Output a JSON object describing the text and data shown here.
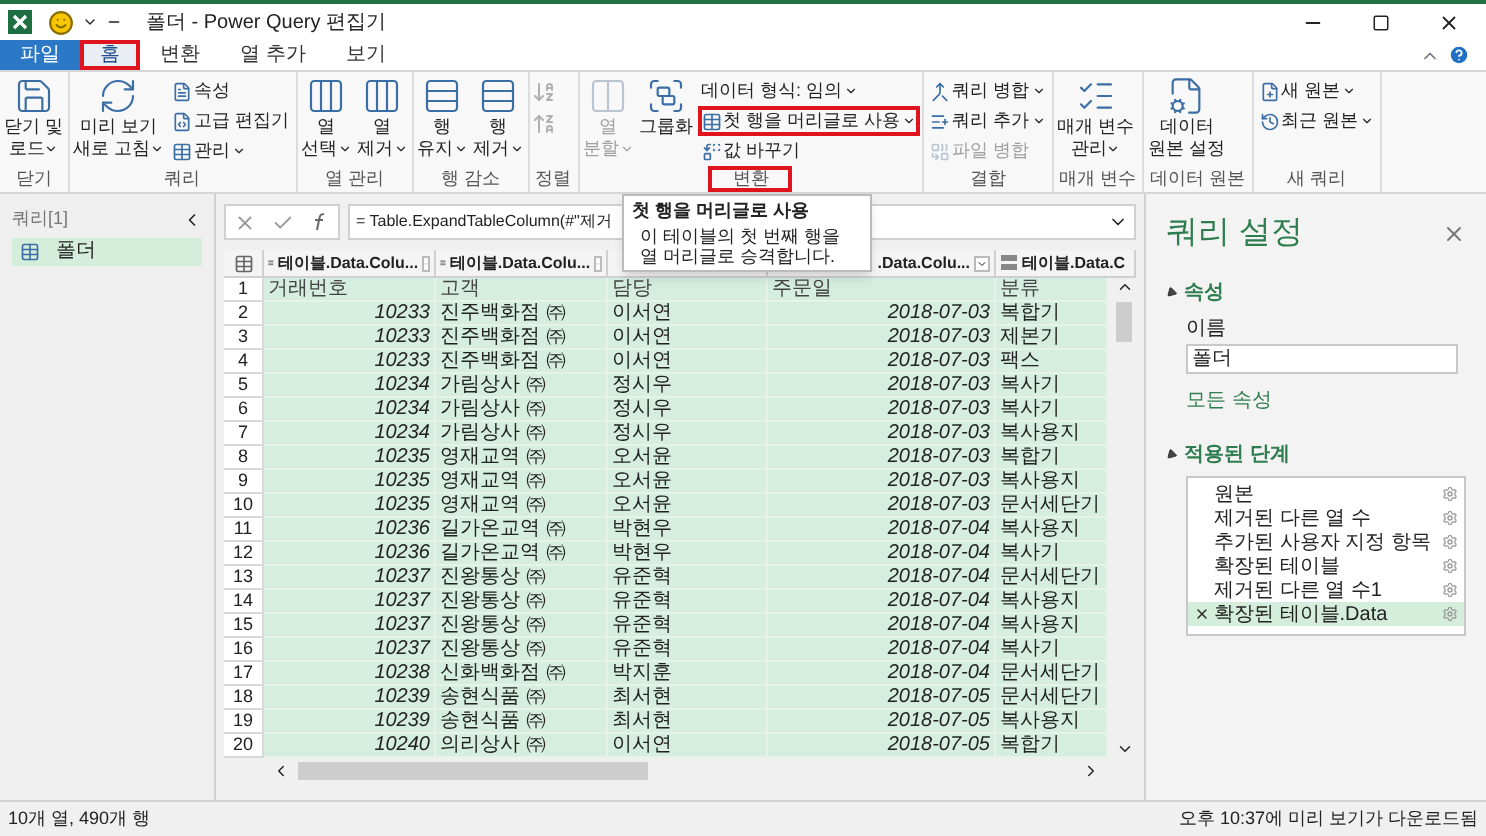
{
  "window": {
    "title": "폴더 - Power Query 편집기"
  },
  "tabs": [
    {
      "label": "파일",
      "kind": "file",
      "selected": false,
      "highlighted": false
    },
    {
      "label": "홈",
      "kind": "tab",
      "selected": true,
      "highlighted": true
    },
    {
      "label": "변환",
      "kind": "tab",
      "selected": false,
      "highlighted": false
    },
    {
      "label": "열 추가",
      "kind": "tab",
      "selected": false,
      "highlighted": false
    },
    {
      "label": "보기",
      "kind": "tab",
      "selected": false,
      "highlighted": false
    }
  ],
  "ribbon": {
    "groups": [
      {
        "label": "닫기",
        "highlighted": false,
        "items": [
          {
            "kind": "large",
            "lines": [
              "닫기 및",
              "로드"
            ],
            "dropdown": true,
            "disabled": false
          }
        ]
      },
      {
        "label": "쿼리",
        "highlighted": false,
        "items": [
          {
            "kind": "large",
            "lines": [
              "미리 보기",
              "새로 고침"
            ],
            "dropdown": true,
            "disabled": false
          },
          {
            "kind": "stack",
            "items": [
              {
                "label": "속성",
                "icon": true,
                "dropdown": false,
                "disabled": false,
                "highlighted": false
              },
              {
                "label": "고급 편집기",
                "icon": true,
                "dropdown": false,
                "disabled": false,
                "highlighted": false
              },
              {
                "label": "관리",
                "icon": true,
                "dropdown": true,
                "disabled": false,
                "highlighted": false
              }
            ]
          }
        ]
      },
      {
        "label": "열 관리",
        "highlighted": false,
        "items": [
          {
            "kind": "large",
            "lines": [
              "열",
              "선택"
            ],
            "dropdown": true,
            "disabled": false
          },
          {
            "kind": "large",
            "lines": [
              "열",
              "제거"
            ],
            "dropdown": true,
            "disabled": false
          }
        ]
      },
      {
        "label": "행 감소",
        "highlighted": false,
        "items": [
          {
            "kind": "large",
            "lines": [
              "행",
              "유지"
            ],
            "dropdown": true,
            "disabled": false
          },
          {
            "kind": "large",
            "lines": [
              "행",
              "제거"
            ],
            "dropdown": true,
            "disabled": false
          }
        ]
      },
      {
        "label": "정렬",
        "highlighted": false,
        "items": [
          {
            "kind": "sort",
            "disabled": true
          }
        ]
      },
      {
        "label": "변환",
        "highlighted": true,
        "items": [
          {
            "kind": "large",
            "lines": [
              "열",
              "분할"
            ],
            "dropdown": true,
            "disabled": true
          },
          {
            "kind": "large",
            "lines": [
              "그룹화"
            ],
            "dropdown": false,
            "disabled": false
          },
          {
            "kind": "stack",
            "items": [
              {
                "label": "데이터 형식: 임의",
                "icon": false,
                "dropdown": true,
                "disabled": false,
                "highlighted": false
              },
              {
                "label": "첫 행을 머리글로 사용",
                "icon": true,
                "dropdown": true,
                "disabled": false,
                "highlighted": true
              },
              {
                "label": "값 바꾸기",
                "icon": true,
                "dropdown": false,
                "disabled": false,
                "highlighted": false
              }
            ]
          }
        ]
      },
      {
        "label": "결합",
        "highlighted": false,
        "items": [
          {
            "kind": "stack",
            "items": [
              {
                "label": "쿼리 병합",
                "icon": true,
                "dropdown": true,
                "disabled": false,
                "highlighted": false
              },
              {
                "label": "쿼리 추가",
                "icon": true,
                "dropdown": true,
                "disabled": false,
                "highlighted": false
              },
              {
                "label": "파일 병합",
                "icon": true,
                "dropdown": false,
                "disabled": true,
                "highlighted": false
              }
            ]
          }
        ]
      },
      {
        "label": "매개 변수",
        "highlighted": false,
        "items": [
          {
            "kind": "large",
            "lines": [
              "매개 변수",
              "관리"
            ],
            "dropdown": true,
            "disabled": false
          }
        ]
      },
      {
        "label": "데이터 원본",
        "highlighted": false,
        "items": [
          {
            "kind": "large",
            "lines": [
              "데이터",
              "원본 설정"
            ],
            "dropdown": false,
            "disabled": false
          }
        ]
      },
      {
        "label": "새 쿼리",
        "highlighted": false,
        "items": [
          {
            "kind": "stack",
            "items": [
              {
                "label": "새 원본",
                "icon": true,
                "dropdown": true,
                "disabled": false,
                "highlighted": false
              },
              {
                "label": "최근 원본",
                "icon": true,
                "dropdown": true,
                "disabled": false,
                "highlighted": false
              }
            ]
          }
        ]
      }
    ]
  },
  "query_panel": {
    "title": "쿼리[1]",
    "items": [
      {
        "label": "폴더",
        "selected": true
      }
    ]
  },
  "formula": "= Table.ExpandTableColumn(#\"제거",
  "tooltip": {
    "title": "첫 행을 머리글로 사용",
    "text": "이 테이블의 첫 번째 행을 열 머리글로 승격합니다."
  },
  "table": {
    "columns": [
      {
        "label": "테이블.Data.Colu...",
        "type_icon": true,
        "dropdown": true
      },
      {
        "label": "테이블.Data.Colu...",
        "type_icon": true,
        "dropdown": true
      },
      {},
      {
        "label": ".Data.Colu...",
        "type_icon": false,
        "dropdown": true
      },
      {
        "label": "테이블.Data.C",
        "type_icon": true,
        "dropdown": false
      }
    ],
    "rows": [
      {
        "number": "1",
        "kind": "header",
        "cells": [
          "거래번호",
          "고객",
          "담당",
          "주문일",
          "분류"
        ]
      },
      {
        "number": "2",
        "kind": "data",
        "cells": [
          "10233",
          "진주백화점 ㈜",
          "이서연",
          "2018-07-03",
          "복합기"
        ]
      },
      {
        "number": "3",
        "kind": "data",
        "cells": [
          "10233",
          "진주백화점 ㈜",
          "이서연",
          "2018-07-03",
          "제본기"
        ]
      },
      {
        "number": "4",
        "kind": "data",
        "cells": [
          "10233",
          "진주백화점 ㈜",
          "이서연",
          "2018-07-03",
          "팩스"
        ]
      },
      {
        "number": "5",
        "kind": "data",
        "cells": [
          "10234",
          "가림상사 ㈜",
          "정시우",
          "2018-07-03",
          "복사기"
        ]
      },
      {
        "number": "6",
        "kind": "data",
        "cells": [
          "10234",
          "가림상사 ㈜",
          "정시우",
          "2018-07-03",
          "복사기"
        ]
      },
      {
        "number": "7",
        "kind": "data",
        "cells": [
          "10234",
          "가림상사 ㈜",
          "정시우",
          "2018-07-03",
          "복사용지"
        ]
      },
      {
        "number": "8",
        "kind": "data",
        "cells": [
          "10235",
          "영재교역 ㈜",
          "오서윤",
          "2018-07-03",
          "복합기"
        ]
      },
      {
        "number": "9",
        "kind": "data",
        "cells": [
          "10235",
          "영재교역 ㈜",
          "오서윤",
          "2018-07-03",
          "복사용지"
        ]
      },
      {
        "number": "10",
        "kind": "data",
        "cells": [
          "10235",
          "영재교역 ㈜",
          "오서윤",
          "2018-07-03",
          "문서세단기"
        ]
      },
      {
        "number": "11",
        "kind": "data",
        "cells": [
          "10236",
          "길가온교역 ㈜",
          "박현우",
          "2018-07-04",
          "복사용지"
        ]
      },
      {
        "number": "12",
        "kind": "data",
        "cells": [
          "10236",
          "길가온교역 ㈜",
          "박현우",
          "2018-07-04",
          "복사기"
        ]
      },
      {
        "number": "13",
        "kind": "data",
        "cells": [
          "10237",
          "진왕통상 ㈜",
          "유준혁",
          "2018-07-04",
          "문서세단기"
        ]
      },
      {
        "number": "14",
        "kind": "data",
        "cells": [
          "10237",
          "진왕통상 ㈜",
          "유준혁",
          "2018-07-04",
          "복사용지"
        ]
      },
      {
        "number": "15",
        "kind": "data",
        "cells": [
          "10237",
          "진왕통상 ㈜",
          "유준혁",
          "2018-07-04",
          "복사용지"
        ]
      },
      {
        "number": "16",
        "kind": "data",
        "cells": [
          "10237",
          "진왕통상 ㈜",
          "유준혁",
          "2018-07-04",
          "복사기"
        ]
      },
      {
        "number": "17",
        "kind": "data",
        "cells": [
          "10238",
          "신화백화점 ㈜",
          "박지훈",
          "2018-07-04",
          "문서세단기"
        ]
      },
      {
        "number": "18",
        "kind": "data",
        "cells": [
          "10239",
          "송현식품 ㈜",
          "최서현",
          "2018-07-05",
          "문서세단기"
        ]
      },
      {
        "number": "19",
        "kind": "data",
        "cells": [
          "10239",
          "송현식품 ㈜",
          "최서현",
          "2018-07-05",
          "복사용지"
        ]
      },
      {
        "number": "20",
        "kind": "data",
        "cells": [
          "10240",
          "의리상사 ㈜",
          "이서연",
          "2018-07-05",
          "복합기"
        ]
      }
    ]
  },
  "settings": {
    "title": "쿼리 설정",
    "properties": {
      "heading": "속성",
      "expanded": true,
      "name_label": "이름",
      "name_value": "폴더",
      "all_properties": "모든 속성"
    },
    "steps": {
      "heading": "적용된 단계",
      "expanded": true,
      "items": [
        {
          "label": "원본",
          "selected": false
        },
        {
          "label": "제거된 다른 열 수",
          "selected": false
        },
        {
          "label": "추가된 사용자 지정 항목",
          "selected": false
        },
        {
          "label": "확장된 테이블",
          "selected": false
        },
        {
          "label": "제거된 다른 열 수1",
          "selected": false
        },
        {
          "label": "확장된 테이블.Data",
          "selected": true
        }
      ]
    }
  },
  "status_bar": {
    "left": "10개 열, 490개 행",
    "right": "오후 10:37에 미리 보기가 다운로드됨"
  }
}
